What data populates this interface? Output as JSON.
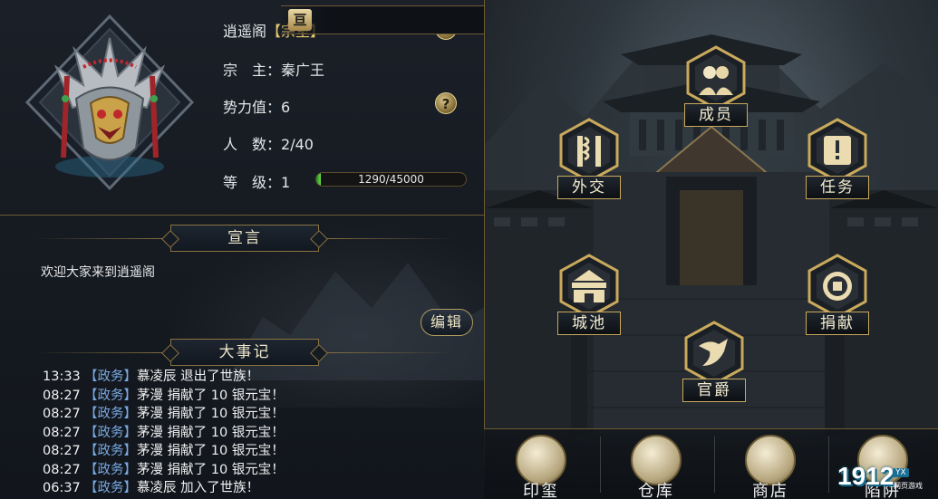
{
  "guild": {
    "name": "逍遥阁",
    "name_suffix": "【宗室】",
    "leader_label": "宗　主：",
    "leader_value": "秦广王",
    "power_label": "势力值：",
    "power_value": "6",
    "count_label": "人　数：",
    "count_value": "2/40",
    "level_label": "等　级：",
    "level_value": "1",
    "exp_text": "1290/45000",
    "exp_fraction": 0.0287,
    "title_glyph": "亘"
  },
  "declaration": {
    "banner": "宣言",
    "text": "欢迎大家来到逍遥阁",
    "edit_label": "编辑"
  },
  "events": {
    "banner": "大事记",
    "items": [
      {
        "time": "13:33",
        "cat": "【政务】",
        "text": "慕凌辰 退出了世族！"
      },
      {
        "time": "08:27",
        "cat": "【政务】",
        "text": "茅漫 捐献了 10 银元宝！"
      },
      {
        "time": "08:27",
        "cat": "【政务】",
        "text": "茅漫 捐献了 10 银元宝！"
      },
      {
        "time": "08:27",
        "cat": "【政务】",
        "text": "茅漫 捐献了 10 银元宝！"
      },
      {
        "time": "08:27",
        "cat": "【政务】",
        "text": "茅漫 捐献了 10 银元宝！"
      },
      {
        "time": "08:27",
        "cat": "【政务】",
        "text": "茅漫 捐献了 10 银元宝！"
      },
      {
        "time": "06:37",
        "cat": "【政务】",
        "text": "慕凌辰 加入了世族！"
      }
    ]
  },
  "scene_buttons": {
    "members": "成员",
    "diplomacy": "外交",
    "tasks": "任务",
    "city": "城池",
    "donate": "捐献",
    "rank": "官爵"
  },
  "bottom_buttons": {
    "seal": "印玺",
    "warehouse": "仓库",
    "shop": "商店",
    "trap": "陷阱"
  },
  "help_glyph": "?",
  "watermark": {
    "main": "1912",
    "tag": "YX",
    "sub": "网页游戏"
  },
  "colors": {
    "gold": "#c9a95c",
    "category_blue": "#79a8e0",
    "exp_green": "#4fc63a"
  }
}
